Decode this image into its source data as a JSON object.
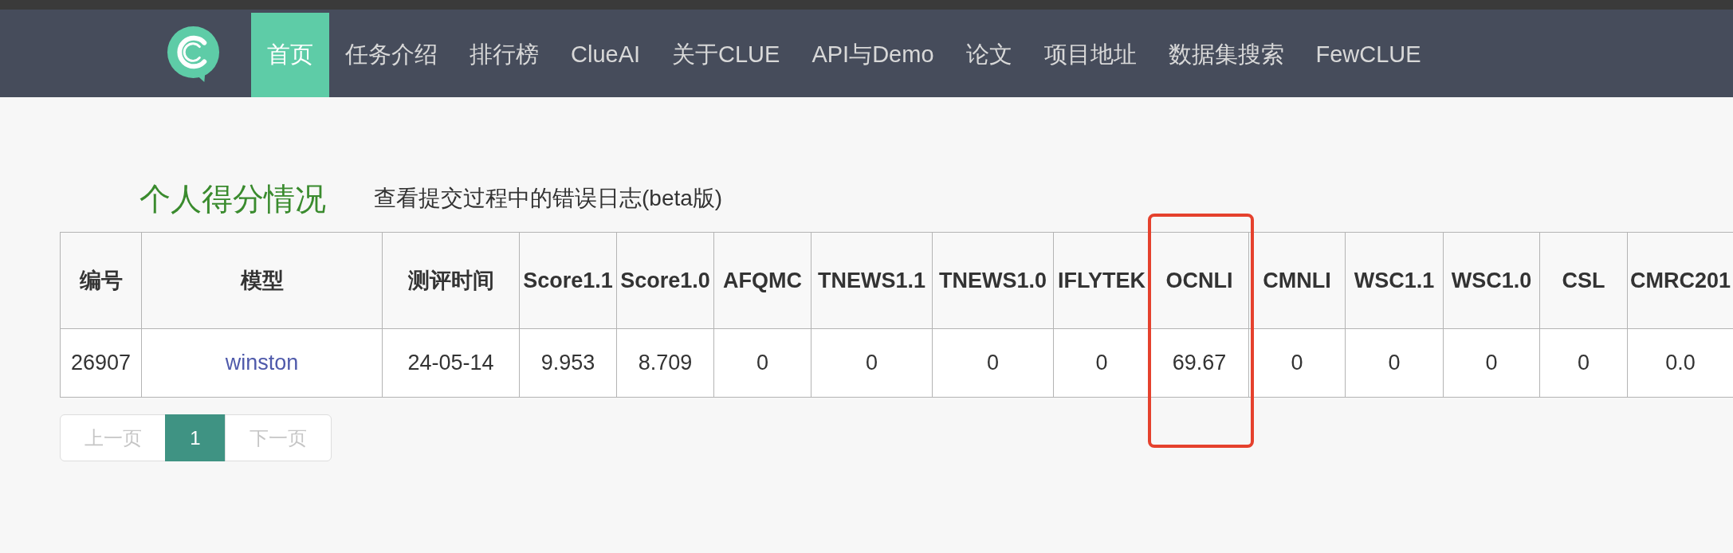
{
  "nav": {
    "items": [
      {
        "label": "首页",
        "selected": true
      },
      {
        "label": "任务介绍",
        "selected": false
      },
      {
        "label": "排行榜",
        "selected": false
      },
      {
        "label": "ClueAI",
        "selected": false
      },
      {
        "label": "关于CLUE",
        "selected": false
      },
      {
        "label": "API与Demo",
        "selected": false
      },
      {
        "label": "论文",
        "selected": false
      },
      {
        "label": "项目地址",
        "selected": false
      },
      {
        "label": "数据集搜索",
        "selected": false
      },
      {
        "label": "FewCLUE",
        "selected": false
      }
    ]
  },
  "heading": {
    "title": "个人得分情况",
    "link": "查看提交过程中的错误日志(beta版)"
  },
  "table": {
    "columns": [
      {
        "label": "编号",
        "highlighted": false
      },
      {
        "label": "模型",
        "highlighted": false
      },
      {
        "label": "测评时间",
        "highlighted": false
      },
      {
        "label": "Score1.1",
        "highlighted": false
      },
      {
        "label": "Score1.0",
        "highlighted": false
      },
      {
        "label": "AFQMC",
        "highlighted": false
      },
      {
        "label": "TNEWS1.1",
        "highlighted": false
      },
      {
        "label": "TNEWS1.0",
        "highlighted": false
      },
      {
        "label": "IFLYTEK",
        "highlighted": false
      },
      {
        "label": "OCNLI",
        "highlighted": true
      },
      {
        "label": "CMNLI",
        "highlighted": false
      },
      {
        "label": "WSC1.1",
        "highlighted": false
      },
      {
        "label": "WSC1.0",
        "highlighted": false
      },
      {
        "label": "CSL",
        "highlighted": false
      },
      {
        "label": "CMRC201",
        "highlighted": false
      }
    ],
    "rows": [
      {
        "cells": [
          {
            "text": "26907",
            "kind": "text"
          },
          {
            "text": "winston",
            "kind": "link"
          },
          {
            "text": "24-05-14",
            "kind": "text"
          },
          {
            "text": "9.953",
            "kind": "text"
          },
          {
            "text": "8.709",
            "kind": "text"
          },
          {
            "text": "0",
            "kind": "text"
          },
          {
            "text": "0",
            "kind": "text"
          },
          {
            "text": "0",
            "kind": "text"
          },
          {
            "text": "0",
            "kind": "text"
          },
          {
            "text": "69.67",
            "kind": "text"
          },
          {
            "text": "0",
            "kind": "text"
          },
          {
            "text": "0",
            "kind": "text"
          },
          {
            "text": "0",
            "kind": "text"
          },
          {
            "text": "0",
            "kind": "text"
          },
          {
            "text": "0.0",
            "kind": "text"
          }
        ]
      }
    ]
  },
  "pagination": [
    {
      "label": "上一页",
      "kind": "prev",
      "selected": false,
      "disabled": true
    },
    {
      "label": "1",
      "kind": "page",
      "selected": true
    },
    {
      "label": "下一页",
      "kind": "next",
      "selected": false,
      "disabled": true
    }
  ]
}
